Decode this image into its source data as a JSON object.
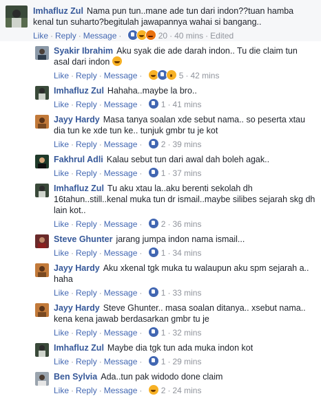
{
  "main": {
    "author": "Imhafluz Zul",
    "text": "Nama pun tun..mane ade tun dari indon??tuan hamba kenal tun suharto?begitulah jawapannya wahai si bangang..",
    "like": "Like",
    "reply": "Reply",
    "message": "Message",
    "reaction_count": "20",
    "time": "40 mins",
    "edited": "Edited"
  },
  "replies": [
    {
      "author": "Syakir Ibrahim",
      "text": "Aku syak die ade darah indon.. Tu die claim tun asal dari indon",
      "like": "Like",
      "reply": "Reply",
      "message": "Message",
      "count": "5",
      "time": "42 mins"
    },
    {
      "author": "Imhafluz Zul",
      "text": "Hahaha..maybe la bro..",
      "like": "Like",
      "reply": "Reply",
      "message": "Message",
      "count": "1",
      "time": "41 mins"
    },
    {
      "author": "Jayy Hardy",
      "text": "Masa tanya soalan xde sebut nama.. so peserta xtau dia tun ke xde tun ke.. tunjuk gmbr tu je kot",
      "like": "Like",
      "reply": "Reply",
      "message": "Message",
      "count": "2",
      "time": "39 mins"
    },
    {
      "author": "Fakhrul Adli",
      "text": "Kalau sebut tun dari awal dah boleh agak..",
      "like": "Like",
      "reply": "Reply",
      "message": "Message",
      "count": "1",
      "time": "37 mins"
    },
    {
      "author": "Imhafluz Zul",
      "text": "Tu aku xtau la..aku berenti sekolah dh 16tahun..still..kenal muka tun dr ismail..maybe silibes sejarah skg dh lain kot..",
      "like": "Like",
      "reply": "Reply",
      "message": "Message",
      "count": "2",
      "time": "36 mins"
    },
    {
      "author": "Steve Ghunter",
      "text": "jarang jumpa indon nama ismail...",
      "like": "Like",
      "reply": "Reply",
      "message": "Message",
      "count": "1",
      "time": "34 mins"
    },
    {
      "author": "Jayy Hardy",
      "text": "Aku xkenal tgk muka tu walaupun aku spm sejarah a.. haha",
      "like": "Like",
      "reply": "Reply",
      "message": "Message",
      "count": "1",
      "time": "33 mins"
    },
    {
      "author": "Jayy Hardy",
      "text": "Steve Ghunter.. masa soalan ditanya.. xsebut nama.. kena kena jawab berdasarkan gmbr tu je",
      "like": "Like",
      "reply": "Reply",
      "message": "Message",
      "count": "1",
      "time": "32 mins"
    },
    {
      "author": "Imhafluz Zul",
      "text": "Maybe dia tgk tun ada muka indon kot",
      "like": "Like",
      "reply": "Reply",
      "message": "Message",
      "count": "1",
      "time": "29 mins"
    },
    {
      "author": "Ben Sylvia",
      "text": "Ada..tun pak widodo done claim",
      "like": "Like",
      "reply": "Reply",
      "message": "Message",
      "count": "2",
      "time": "24 mins"
    }
  ],
  "colors": {
    "link": "#4267b2",
    "author": "#365899",
    "meta": "#90949c",
    "main_bg": "#f6f7f9"
  }
}
